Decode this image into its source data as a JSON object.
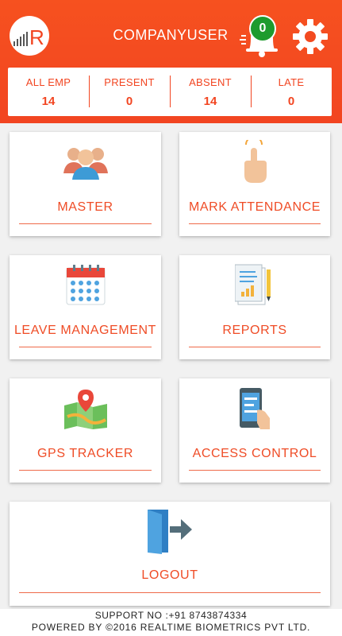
{
  "header": {
    "title": "COMPANYUSER",
    "notification_count": "0",
    "logo_letter": "R",
    "accent_color": "#f24521"
  },
  "stats": [
    {
      "label": "ALL EMP",
      "value": "14"
    },
    {
      "label": "PRESENT",
      "value": "0"
    },
    {
      "label": "ABSENT",
      "value": "14"
    },
    {
      "label": "LATE",
      "value": "0"
    }
  ],
  "menu": [
    {
      "label": "MASTER",
      "icon": "users-group-icon"
    },
    {
      "label": "MARK ATTENDANCE",
      "icon": "hand-tap-icon"
    },
    {
      "label": "LEAVE MANAGEMENT",
      "icon": "calendar-icon"
    },
    {
      "label": "REPORTS",
      "icon": "report-document-icon"
    },
    {
      "label": "GPS TRACKER",
      "icon": "map-pin-icon"
    },
    {
      "label": "ACCESS CONTROL",
      "icon": "phone-access-icon"
    },
    {
      "label": "LOGOUT",
      "icon": "logout-door-icon"
    }
  ],
  "footer": {
    "support": "SUPPORT NO :+91 8743874334",
    "powered": "POWERED BY ©2016 REALTIME BIOMETRICS PVT LTD."
  }
}
